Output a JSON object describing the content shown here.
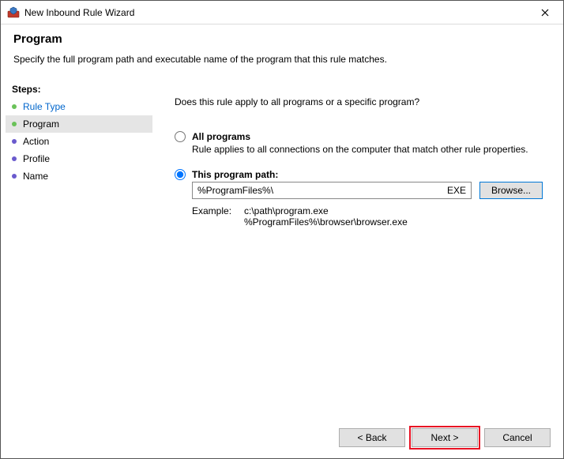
{
  "window": {
    "title": "New Inbound Rule Wizard"
  },
  "header": {
    "title": "Program",
    "subtitle": "Specify the full program path and executable name of the program that this rule matches."
  },
  "sidebar": {
    "steps_label": "Steps:",
    "items": [
      {
        "label": "Rule Type",
        "link": true,
        "bullet": "green",
        "current": false
      },
      {
        "label": "Program",
        "link": false,
        "bullet": "green",
        "current": true
      },
      {
        "label": "Action",
        "link": false,
        "bullet": "purple",
        "current": false
      },
      {
        "label": "Profile",
        "link": false,
        "bullet": "purple",
        "current": false
      },
      {
        "label": "Name",
        "link": false,
        "bullet": "purple",
        "current": false
      }
    ]
  },
  "main": {
    "question": "Does this rule apply to all programs or a specific program?",
    "options": {
      "all": {
        "label": "All programs",
        "desc": "Rule applies to all connections on the computer that match other rule properties."
      },
      "path": {
        "label": "This program path:",
        "value": "%ProgramFiles%\\",
        "suffix": "EXE",
        "browse": "Browse...",
        "example_label": "Example:",
        "example1": "c:\\path\\program.exe",
        "example2": "%ProgramFiles%\\browser\\browser.exe"
      }
    }
  },
  "buttons": {
    "back": "< Back",
    "next": "Next >",
    "cancel": "Cancel"
  }
}
